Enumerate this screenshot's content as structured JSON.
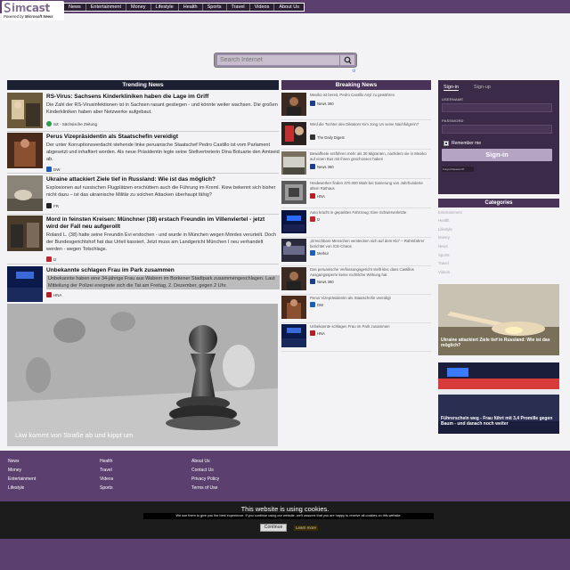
{
  "brand": {
    "logo_text_s": "s",
    "logo_text_sim": "im",
    "logo_text_cast": "cast",
    "powered_by": "Powered by",
    "powered_name": "Microsoft News"
  },
  "nav": [
    "News",
    "Entertainment",
    "Money",
    "Lifestyle",
    "Health",
    "Sports",
    "Travel",
    "Videos",
    "About Us"
  ],
  "search": {
    "placeholder": "Search Internet",
    "settings_icon": "gear-icon"
  },
  "trending": {
    "heading": "Trending News",
    "items": [
      {
        "title": "RS-Virus: Sachsens Kinderkliniken haben die Lage im Griff",
        "body": "Die Zahl der RS-Virusinfektionen ist in Sachsen rasant gestiegen - und könnte weiter wachsen. Die großen Kinderkliniken haben aber Netzwerke aufgebaut.",
        "source": "SZ - Sächsische Zeitung",
        "source_color": "#2e9b4b"
      },
      {
        "title": "Perus Vizepräsidentin als Staatschefin vereidigt",
        "body": "Der unter Korruptionsverdacht stehende linke peruanische Staatschef Pedro Castillo ist vom Parlament abgesetzt und inhaftiert worden. Als neue Präsidentin legte seine Stellvertreterin Dina Boluarte den Amtseid ab.",
        "source": "DW",
        "source_color": "#1d5fb3"
      },
      {
        "title": "Ukraine attackiert Ziele tief in Russland: Wie ist das möglich?",
        "body": "Explosionen auf russischen Flugplätzen erschüttern auch die Führung im Kreml. Kiew bekennt sich bisher nicht dazu – ist das ukrainische Militär zu solchen Attacken überhaupt fähig?",
        "source": "FR",
        "source_color": "#222222"
      },
      {
        "title": "Mord in feinsten Kreisen: Münchner (38) erstach Freundin im Villenviertel - jetzt wird der Fall neu aufgerollt",
        "body": "Roland L. (38) hatte seine Freundin Evi erstochen - und wurde in München wegen Mordes verurteilt. Doch der Bundesgerichtshof hat das Urteil kassiert. Jetzt muss am Landgericht München I neu verhandelt werden - wegen Totschlags.",
        "source": "tz",
        "source_color": "#c0262d"
      },
      {
        "title": "Unbekannte schlagen Frau im Park zusammen",
        "body": "Unbekannte haben eine 34-jährige Frau aus Wabern im Borkener Stadtpark zusammengeschlagen. Laut Mitteilung der Polizei ereignete sich die Tat am Freitag, 2. Dezember, gegen 2 Uhr.",
        "source": "HNA",
        "source_color": "#b31f24"
      }
    ],
    "hero_caption": "Lkw kommt von Straße ab und kippt um"
  },
  "breaking": {
    "heading": "Breaking News",
    "items": [
      {
        "title": "Mexiko ist bereit, Pedro Castillo Asyl zu gewähren",
        "source": "News 360",
        "source_color": "#1d3e8c"
      },
      {
        "title": "Wird die Tochter des Diktators Kim Jong Un seine Nachfolgerin?",
        "source": "The Daily Digest",
        "source_color": "#333333"
      },
      {
        "title": "Bewaffnete entführen mehr als 30 Migranten, nachdem sie in Mexiko auf einen Bus mit ihnen geschossen haben",
        "source": "News 360",
        "source_color": "#1d3e8c"
      },
      {
        "title": "Heidewerker finden 370.000 Mark bei Sanierung von Jahrhunderte altem Rathaus",
        "source": "HNA",
        "source_color": "#b31f24"
      },
      {
        "title": "Auto kracht in geparktes Fahrzeug: Eine Schwerverletzte",
        "source": "tz",
        "source_color": "#c0262d"
      },
      {
        "title": "„Erreichbare Menschen verstecken sich auf dem Klo“ – Rahmfahrer berichtet von ICE-Chaos",
        "source": "Merkur",
        "source_color": "#1d5fb3"
      },
      {
        "title": "Das peruanische Verfassungsgericht stellt klar, dass Castillos Ausgangssperre keine rechtliche Wirkung hat",
        "source": "News 360",
        "source_color": "#1d3e8c"
      },
      {
        "title": "Perus Vizepräsidentin als Staatschefin vereidigt",
        "source": "DW",
        "source_color": "#1d5fb3"
      },
      {
        "title": "Unbekannte schlagen Frau im Park zusammen",
        "source": "HNA",
        "source_color": "#b31f24"
      }
    ]
  },
  "signin": {
    "tab_signin": "Sign-in",
    "tab_signup": "Sign-up",
    "username_label": "USERNAME",
    "username_value": "",
    "password_label": "PASSWORD",
    "password_value": "",
    "remember_label": "Remember me",
    "button_label": "Sign-in",
    "forgot_label": "Forgot Password?"
  },
  "categories": {
    "heading": "Categories",
    "items": [
      "Entertainment",
      "Health",
      "Lifestyle",
      "Money",
      "News",
      "Sports",
      "Travel",
      "Videos"
    ]
  },
  "side_cards": [
    {
      "caption": "Ukraine attackiert Ziele tief in Russland: Wie ist das möglich?"
    },
    {
      "caption": "Führerschein weg - Frau führt mit 3,4 Promille gegen Baum - und danach noch weiter"
    }
  ],
  "footer": {
    "col1": [
      "News",
      "Money",
      "Entertainment",
      "Lifestyle"
    ],
    "col2": [
      "Health",
      "Travel",
      "Videos",
      "Sports"
    ],
    "col3": [
      "About Us",
      "Contact Us",
      "Privacy Policy",
      "Terms of Use"
    ]
  },
  "cookie": {
    "title": "This website is using cookies.",
    "text": "We use them to give you the best experience. If you continue using our website, we'll assume that you are happy to receive all cookies on this website.",
    "continue_label": "Continue",
    "learn_label": "Learn more"
  }
}
